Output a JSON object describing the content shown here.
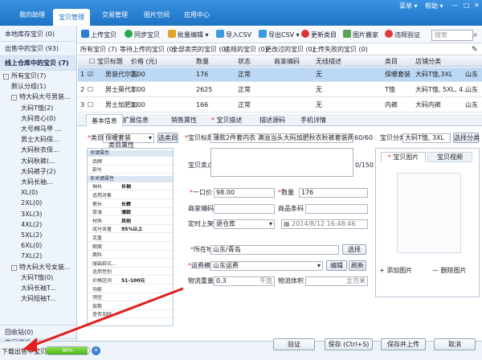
{
  "topnav": {
    "tabs": [
      "我的助理",
      "宝贝管理",
      "交易管理",
      "图片空间",
      "应用中心"
    ],
    "active_tab": "宝贝管理",
    "menu_label": "菜单",
    "help_label": "帮助",
    "colors": {
      "bar": "#1f73c4",
      "arrow": "#e02020"
    }
  },
  "sidebar": {
    "local_stock": "本地库存宝贝 (0)",
    "selling": "出售中的宝贝 (93)",
    "warehouse": "线上仓库中的宝贝 (7)",
    "tree": [
      {
        "label": "所有宝贝(7)",
        "level": 0,
        "toggle": "-"
      },
      {
        "label": "默认分组(1)",
        "level": 1
      },
      {
        "label": "特大码大号男装...",
        "level": 1,
        "toggle": "-"
      },
      {
        "label": "大码T恤(2)",
        "level": 2
      },
      {
        "label": "大码背心(0)",
        "level": 2
      },
      {
        "label": "大号棉马甲 ...",
        "level": 2
      },
      {
        "label": "男士大码保...",
        "level": 2
      },
      {
        "label": "大码秋衣保...",
        "level": 2
      },
      {
        "label": "大码秋裤(...",
        "level": 2
      },
      {
        "label": "大码裤子(2)",
        "level": 2
      },
      {
        "label": "大码长袖...",
        "level": 2
      },
      {
        "label": "XL(0)",
        "level": 2
      },
      {
        "label": "2XL(0)",
        "level": 2
      },
      {
        "label": "3XL(3)",
        "level": 2
      },
      {
        "label": "4XL(2)",
        "level": 2
      },
      {
        "label": "5XL(2)",
        "level": 2
      },
      {
        "label": "6XL(0)",
        "level": 2
      },
      {
        "label": "7XL(2)",
        "level": 2
      },
      {
        "label": "特大码大号女装...",
        "level": 1,
        "toggle": "-"
      },
      {
        "label": "大码T恤(0)",
        "level": 2
      },
      {
        "label": "大码长袖T...",
        "level": 2
      },
      {
        "label": "大码短袖T...",
        "level": 2
      }
    ],
    "recycle": "回收站(0)",
    "templates": "宝贝模板 (0)"
  },
  "toolbar": {
    "buttons": [
      "上传宝贝",
      "同步宝贝",
      "批量编辑",
      "导入CSV",
      "导出CSV",
      "更新类目",
      "图片搬家",
      "违规验证"
    ],
    "search_placeholder": "搜索"
  },
  "filters": [
    "所有宝贝 (7)",
    "等待上传的宝贝 (0)",
    "全部卖完的宝贝 (0)",
    "违规的宝贝 (0)",
    "更改过的宝贝 (0)",
    "上传失败的宝贝 (0)"
  ],
  "table": {
    "headers": [
      "宝贝标题",
      "价格 (元)",
      "数量",
      "状态",
      "商家编码",
      "无线描述",
      "类目",
      "店铺分类"
    ],
    "rows": [
      {
        "num": "1",
        "title": "男装代尔圆...",
        "price": "3.00",
        "qty": "176",
        "status": "正常",
        "code": "",
        "wireless": "无",
        "category": "保暖套装",
        "shop": "大码T恤,3XL",
        "extra": "山东"
      },
      {
        "num": "2",
        "title": "男士莫代尔...",
        "price": "3.00",
        "qty": "2625",
        "status": "正常",
        "code": "",
        "wireless": "无",
        "category": "T恤",
        "shop": "大码T恤, 5XL, 4...",
        "extra": "山东"
      },
      {
        "num": "3",
        "title": "男士加肥加...",
        "price": "2.00",
        "qty": "166",
        "status": "正常",
        "code": "",
        "wireless": "无",
        "category": "内裤",
        "shop": "大码内裤",
        "extra": "山东"
      }
    ]
  },
  "detail_tabs": [
    "基本信息",
    "扩展信息",
    "销售属性",
    "宝贝描述",
    "描述源码",
    "手机详情"
  ],
  "form": {
    "category_label": "类目",
    "category_value": "保暖套装",
    "select_category_btn": "选类目",
    "attr_title": "类目属性",
    "title_label": "宝贝标题",
    "title_value": "薄款2件套内衣 满溢当头大码加肥秋衣秋裤套装两套包邮",
    "title_count": "60/60",
    "shop_cat_label": "宝贝分类",
    "shop_cat_value": "大码T恤, 3XL",
    "shop_cat_btn": "选择分类",
    "selling_label": "宝贝卖点",
    "selling_count": "0/150",
    "price_label": "一口价",
    "price_value": "98.00",
    "qty_label": "数量",
    "qty_value": "176",
    "code_label": "商家编码",
    "barcode_label": "商品条码",
    "schedule_label": "定时上架",
    "schedule_value": "退仓库",
    "schedule_time": "2014/8/12 16:48:46",
    "location_label": "所在地",
    "location_value": "山东/青岛",
    "location_btn": "选择",
    "freight_label": "运费模板",
    "freight_value": "山东运费",
    "edit_btn": "编辑",
    "refresh_btn": "刷新",
    "weight_label": "物流重量",
    "weight_value": "0.3",
    "weight_unit": "千克",
    "volume_label": "物流体积",
    "volume_unit": "立方米"
  },
  "attributes": [
    {
      "section": "关键属性"
    },
    {
      "k": "品牌",
      "v": ""
    },
    {
      "k": "款号",
      "v": ""
    },
    {
      "section": "非关键属性"
    },
    {
      "k": "袖长",
      "v": "长袖"
    },
    {
      "k": "适用对象",
      "v": ""
    },
    {
      "k": "裤长",
      "v": "长裤"
    },
    {
      "k": "厚薄",
      "v": "薄款"
    },
    {
      "k": "材质",
      "v": "其他"
    },
    {
      "k": "成分含量",
      "v": "95%以上"
    },
    {
      "k": "克重",
      "v": ""
    },
    {
      "k": "图案",
      "v": ""
    },
    {
      "k": "面料",
      "v": ""
    },
    {
      "k": "服装款式...",
      "v": ""
    },
    {
      "k": "适用性别",
      "v": ""
    },
    {
      "k": "价格区间",
      "v": "51-100元"
    },
    {
      "k": "功能",
      "v": ""
    },
    {
      "k": "领型",
      "v": ""
    },
    {
      "k": "层数",
      "v": ""
    },
    {
      "k": "是否加绒",
      "v": ""
    }
  ],
  "images": {
    "tab_images": "宝贝图片",
    "tab_video": "宝贝视频",
    "add_label": "添加图片",
    "delete_label": "删除图片"
  },
  "bottom": {
    "status_text": "下载出售中宝贝",
    "progress_percent": 96,
    "progress_label": "96%",
    "verify_btn": "验证",
    "save_btn": "保存 (Ctrl+S)",
    "save_upload_btn": "保存并上传",
    "cancel_btn": "取消"
  }
}
